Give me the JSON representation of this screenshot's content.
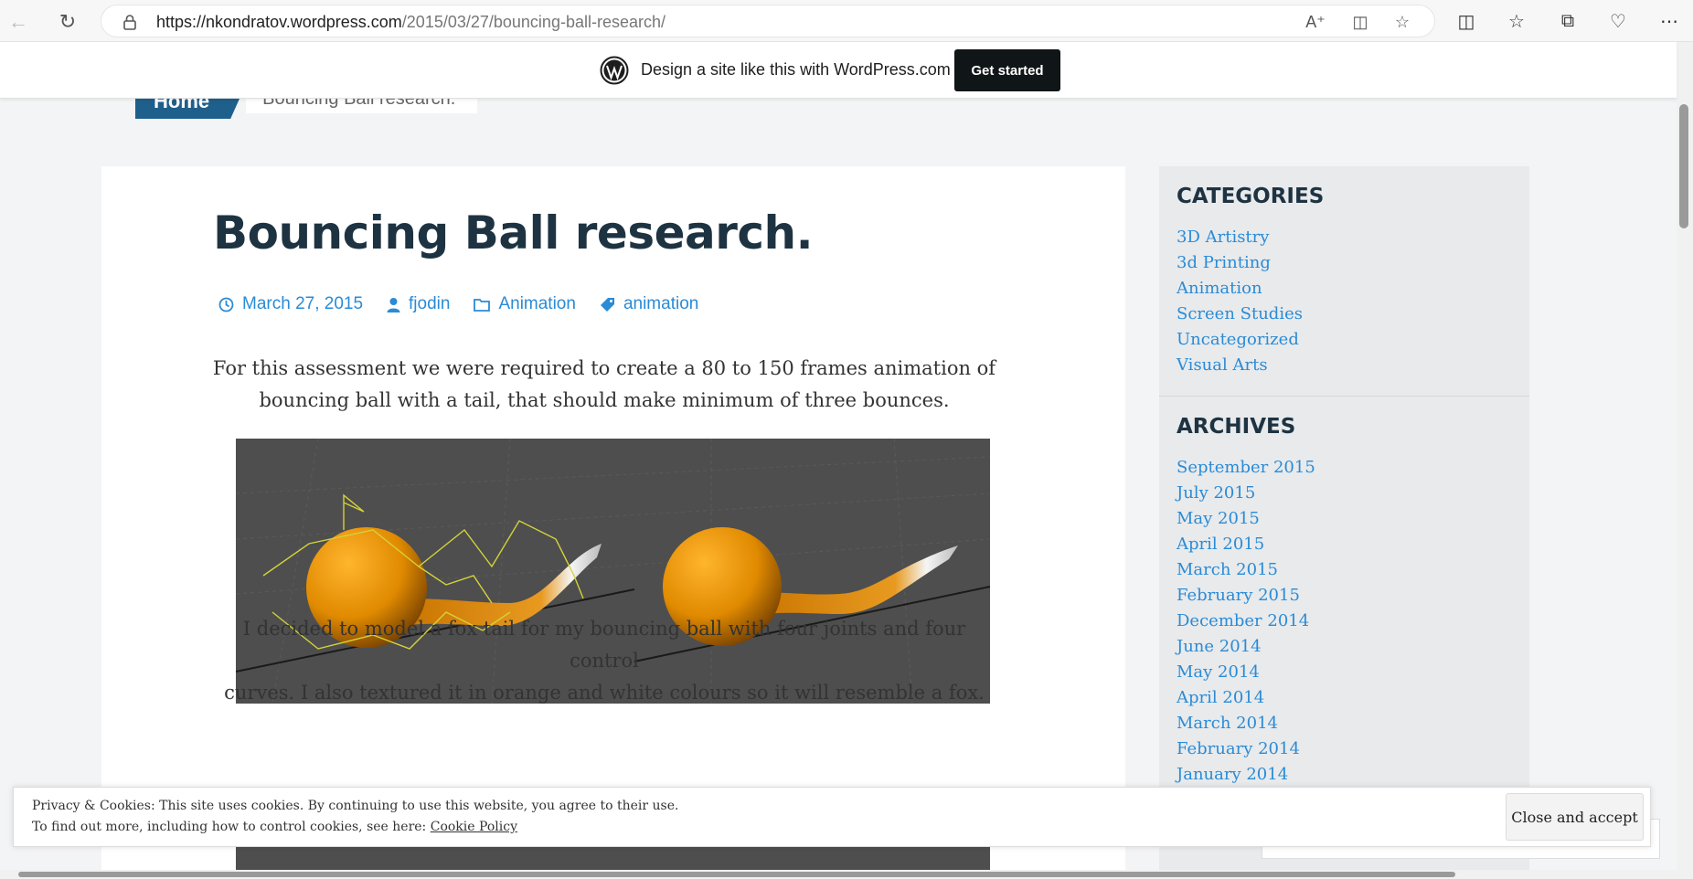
{
  "browser": {
    "url_host": "https://nkondratov.wordpress.com",
    "url_path": "/2015/03/27/bouncing-ball-research/"
  },
  "wp_banner": {
    "text": "Design a site like this with WordPress.com",
    "button": "Get started"
  },
  "breadcrumb": {
    "home": "Home",
    "current": "Bouncing Ball research."
  },
  "post": {
    "title": "Bouncing Ball research.",
    "meta": {
      "date": "March 27, 2015",
      "author": "fjodin",
      "category": "Animation",
      "tag": "animation"
    },
    "paragraph1_line1": "For this assessment we were required to create a 80 to 150 frames animation of",
    "paragraph1_line2": "bouncing ball with a tail, that should make minimum of three bounces.",
    "paragraph2_line1": "I decided to model a fox tail for my bouncing ball with four joints and four control",
    "paragraph2_line2": "curves. I also textured it in orange and white colours so it will resemble a fox."
  },
  "sidebar": {
    "categories_title": "CATEGORIES",
    "categories": [
      "3D Artistry",
      "3d Printing",
      "Animation",
      "Screen Studies",
      "Uncategorized",
      "Visual Arts"
    ],
    "archives_title": "ARCHIVES",
    "archives": [
      "September 2015",
      "July 2015",
      "May 2015",
      "April 2015",
      "March 2015",
      "February 2015",
      "December 2014",
      "June 2014",
      "May 2014",
      "April 2014",
      "March 2014",
      "February 2014",
      "January 2014"
    ]
  },
  "cookie": {
    "line1": "Privacy & Cookies: This site uses cookies. By continuing to use this website, you agree to their use.",
    "line2_prefix": "To find out more, including how to control cookies, see here:",
    "link": "Cookie Policy",
    "button": "Close and accept"
  },
  "colors": {
    "link": "#2a8bd6",
    "title": "#1e3342",
    "ball": "#e08a00"
  }
}
